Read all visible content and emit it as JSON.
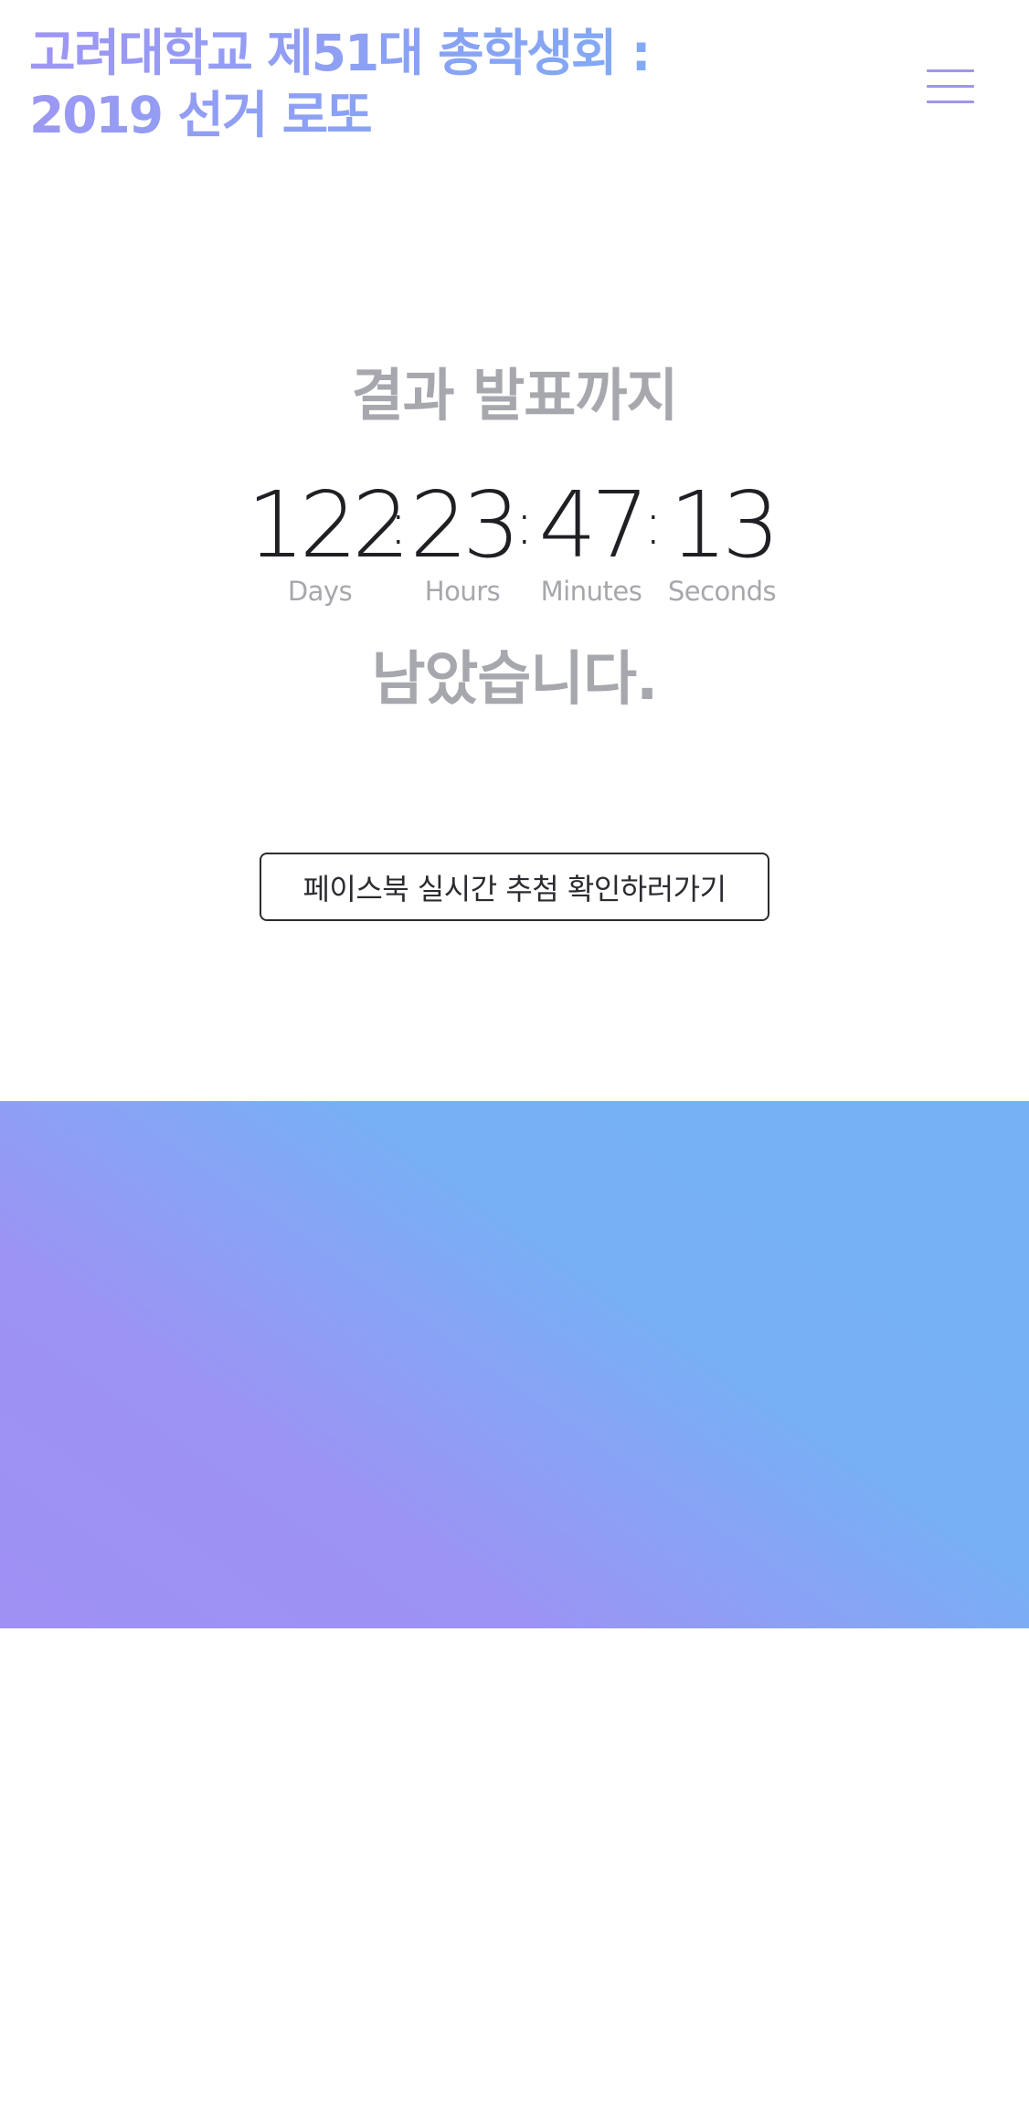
{
  "header": {
    "title_line1": "고려대학교 제51대 총학생회 :",
    "title_line2": "2019 선거 로또",
    "menu_icon": "hamburger-menu-icon"
  },
  "countdown": {
    "until_label": "결과 발표까지",
    "separator": ":",
    "units": {
      "days": {
        "value": "122",
        "label": "Days"
      },
      "hours": {
        "value": "23",
        "label": "Hours"
      },
      "minutes": {
        "value": "47",
        "label": "Minutes"
      },
      "seconds": {
        "value": "13",
        "label": "Seconds"
      }
    },
    "remaining_label": "남았습니다."
  },
  "cta": {
    "facebook_button_label": "페이스북 실시간 추첨 확인하러가기"
  },
  "colors": {
    "title_gradient_start": "#a095f3",
    "title_gradient_end": "#7ab0f5",
    "menu_icon": "#9b96f0",
    "muted_text": "#a6a8ad",
    "digits": "#1f1f24",
    "band_gradient_start": "#9f90f4",
    "band_gradient_end": "#76b1f5"
  }
}
